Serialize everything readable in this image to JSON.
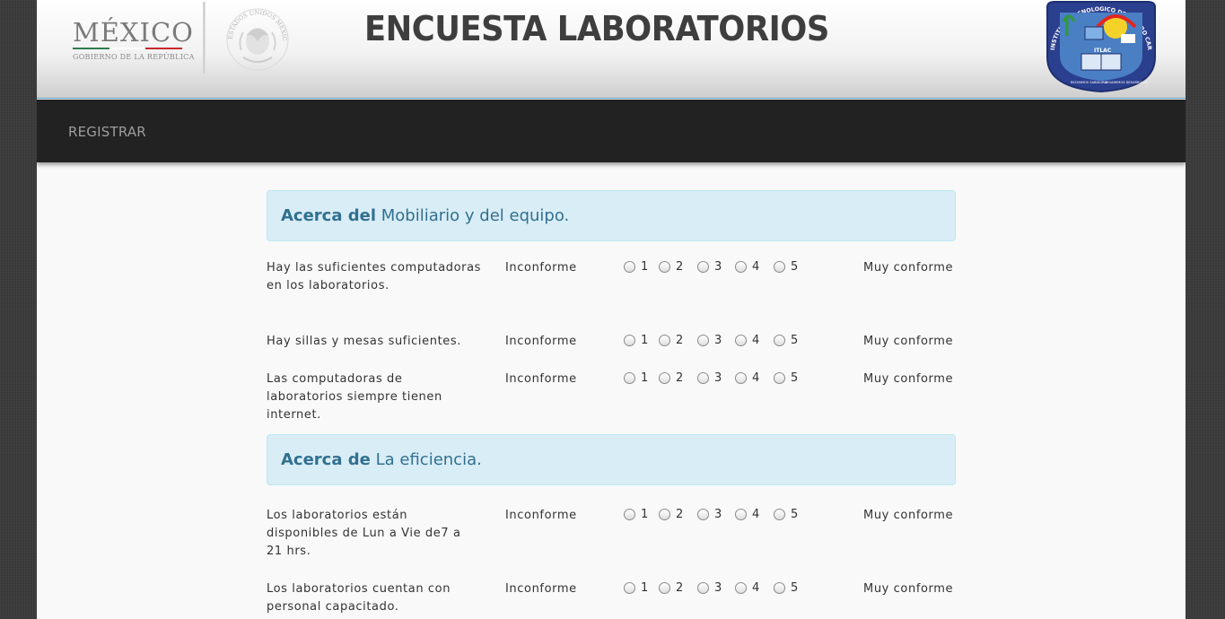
{
  "header": {
    "mexico_word": "MÉXICO",
    "mexico_sub": "GOBIERNO DE LA REPÚBLICA",
    "seal_text": "ESTADOS UNIDOS MEXICANOS",
    "title": "ENCUESTA LABORATORIOS",
    "itlac_ring_top": "INSTITUTO TECNOLOGICO DE LAZARO CARDENAS",
    "itlac_mark": "ITLAC",
    "itlac_motto_left": "RECIBIMOS SABIDURIA",
    "itlac_motto_right": "LEGAREMOS DESARROLLO"
  },
  "nav": {
    "register_label": "REGISTRAR"
  },
  "scale": {
    "left_label": "Inconforme",
    "right_label": "Muy conforme",
    "options": [
      "1",
      "2",
      "3",
      "4",
      "5"
    ]
  },
  "sections": [
    {
      "bold": "Acerca del",
      "rest": "Mobiliario y del equipo.",
      "questions": [
        "Hay las suficientes computadoras en los laboratorios.",
        "Hay sillas y mesas suficientes.",
        "Las computadoras de laboratorios siempre tienen internet."
      ]
    },
    {
      "bold": "Acerca de",
      "rest": "La eficiencia.",
      "questions": [
        "Los laboratorios están disponibles de Lun a Vie de7 a 21 hrs.",
        "Los laboratorios cuentan con personal capacitado."
      ]
    }
  ],
  "colors": {
    "navbar": "#222222",
    "section_bg": "#d9edf7",
    "section_text": "#31708f",
    "mexico_green": "#2e7d4f",
    "mexico_red": "#c8282c",
    "itlac_blue": "#2b3f8f"
  }
}
